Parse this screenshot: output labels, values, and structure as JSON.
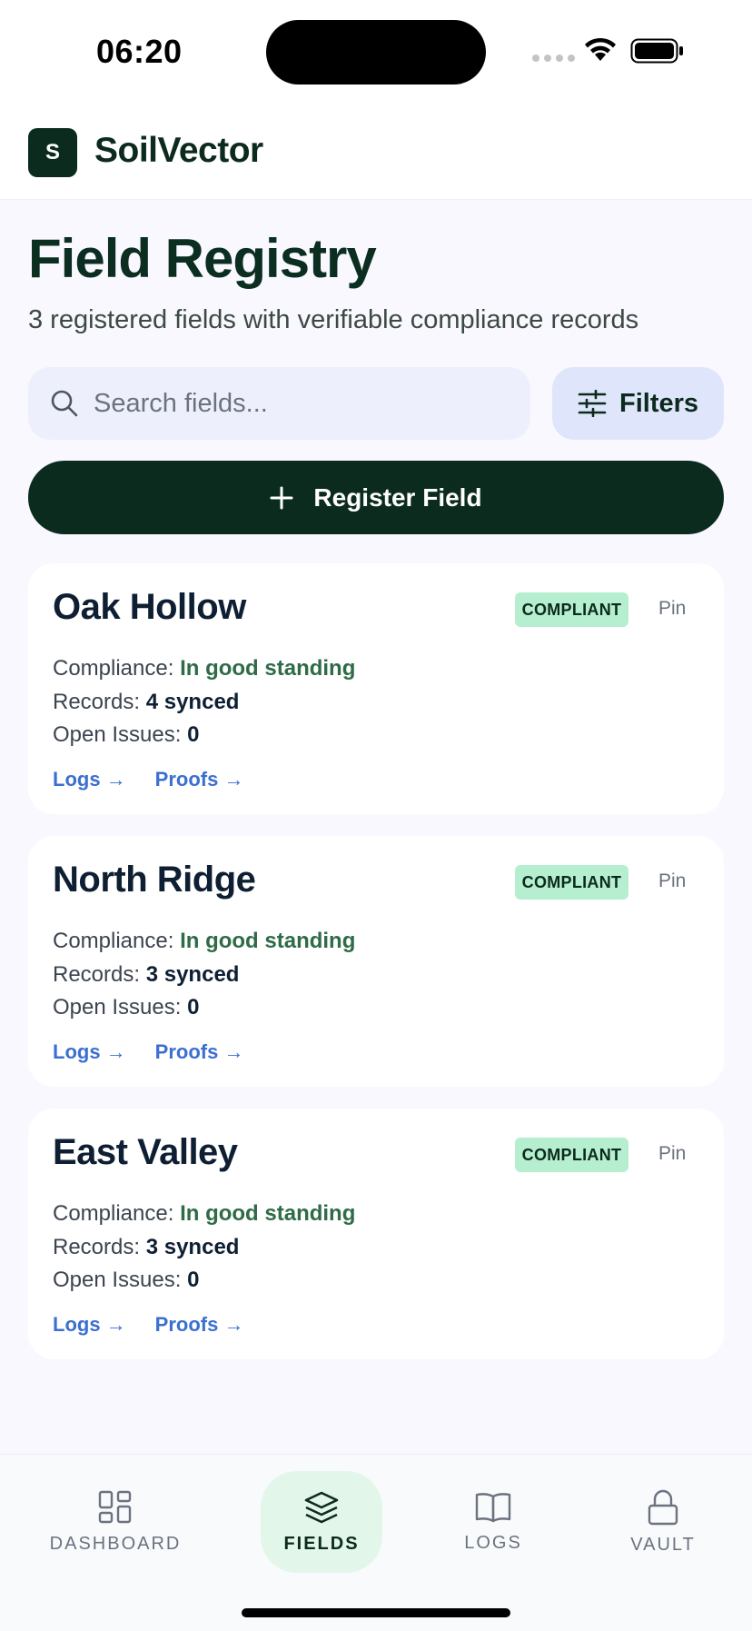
{
  "status_bar": {
    "time": "06:20"
  },
  "app": {
    "logo_letter": "S",
    "name": "SoilVector"
  },
  "page": {
    "title": "Field Registry",
    "subtitle": "3 registered fields with verifiable compliance records"
  },
  "search": {
    "placeholder": "Search fields...",
    "value": ""
  },
  "filters_label": "Filters",
  "register_label": "Register Field",
  "fields": [
    {
      "name": "Oak Hollow",
      "badge": "COMPLIANT",
      "pin_label": "Pin",
      "compliance_label": "Compliance:",
      "compliance_value": "In good standing",
      "records_label": "Records:",
      "records_value": "4 synced",
      "issues_label": "Open Issues:",
      "issues_value": "0",
      "logs_link": "Logs →",
      "proofs_link": "Proofs →"
    },
    {
      "name": "North Ridge",
      "badge": "COMPLIANT",
      "pin_label": "Pin",
      "compliance_label": "Compliance:",
      "compliance_value": "In good standing",
      "records_label": "Records:",
      "records_value": "3 synced",
      "issues_label": "Open Issues:",
      "issues_value": "0",
      "logs_link": "Logs →",
      "proofs_link": "Proofs →"
    },
    {
      "name": "East Valley",
      "badge": "COMPLIANT",
      "pin_label": "Pin",
      "compliance_label": "Compliance:",
      "compliance_value": "In good standing",
      "records_label": "Records:",
      "records_value": "3 synced",
      "issues_label": "Open Issues:",
      "issues_value": "0",
      "logs_link": "Logs →",
      "proofs_link": "Proofs →"
    }
  ],
  "tabs": [
    {
      "label": "DASHBOARD",
      "icon": "grid-icon",
      "active": false
    },
    {
      "label": "FIELDS",
      "icon": "layers-icon",
      "active": true
    },
    {
      "label": "LOGS",
      "icon": "book-icon",
      "active": false
    },
    {
      "label": "VAULT",
      "icon": "lock-icon",
      "active": false
    }
  ],
  "colors": {
    "brand_dark": "#0b2b1f",
    "badge_green": "#b5efcf",
    "link_blue": "#3b6fd1",
    "good_green": "#2f6b47",
    "active_tab_bg": "#e2f6ea"
  }
}
